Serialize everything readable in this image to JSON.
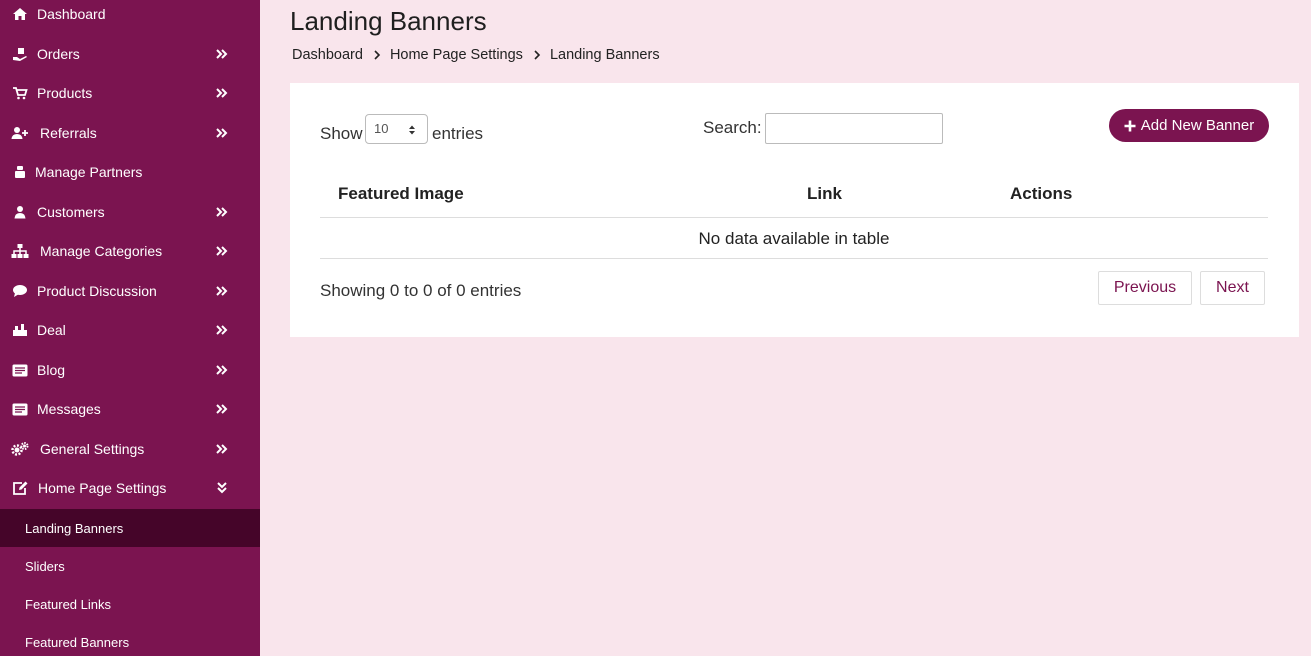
{
  "sidebar": {
    "items": [
      {
        "label": "Dashboard",
        "icon": "home-icon"
      },
      {
        "label": "Orders",
        "icon": "hand-box-icon"
      },
      {
        "label": "Products",
        "icon": "cart-icon"
      },
      {
        "label": "Referrals",
        "icon": "user-plus-icon"
      },
      {
        "label": "Manage Partners",
        "icon": "partners-icon"
      },
      {
        "label": "Customers",
        "icon": "user-icon"
      },
      {
        "label": "Manage Categories",
        "icon": "sitemap-icon"
      },
      {
        "label": "Product Discussion",
        "icon": "chat-icon"
      },
      {
        "label": "Deal",
        "icon": "deal-icon"
      },
      {
        "label": "Blog",
        "icon": "list-card-icon"
      },
      {
        "label": "Messages",
        "icon": "list-card-icon"
      },
      {
        "label": "General Settings",
        "icon": "gears-icon"
      },
      {
        "label": "Home Page Settings",
        "icon": "edit-icon"
      }
    ],
    "subitems": [
      {
        "label": "Landing Banners",
        "active": true
      },
      {
        "label": "Sliders",
        "active": false
      },
      {
        "label": "Featured Links",
        "active": false
      },
      {
        "label": "Featured Banners",
        "active": false
      }
    ]
  },
  "page": {
    "title": "Landing Banners",
    "breadcrumb": [
      "Dashboard",
      "Home Page Settings",
      "Landing Banners"
    ]
  },
  "table_controls": {
    "show_label": "Show",
    "entries_value": "10",
    "entries_label": "entries",
    "search_label": "Search:",
    "search_value": "",
    "add_button_label": "Add New Banner"
  },
  "table": {
    "columns": [
      "Featured Image",
      "Link",
      "Actions"
    ],
    "empty_message": "No data available in table",
    "info": "Showing 0 to 0 of 0 entries",
    "prev_label": "Previous",
    "next_label": "Next"
  },
  "colors": {
    "sidebar_bg": "#7b1450",
    "sidebar_active": "#450529",
    "page_bg": "#f9e5ec",
    "accent": "#7b1450"
  }
}
